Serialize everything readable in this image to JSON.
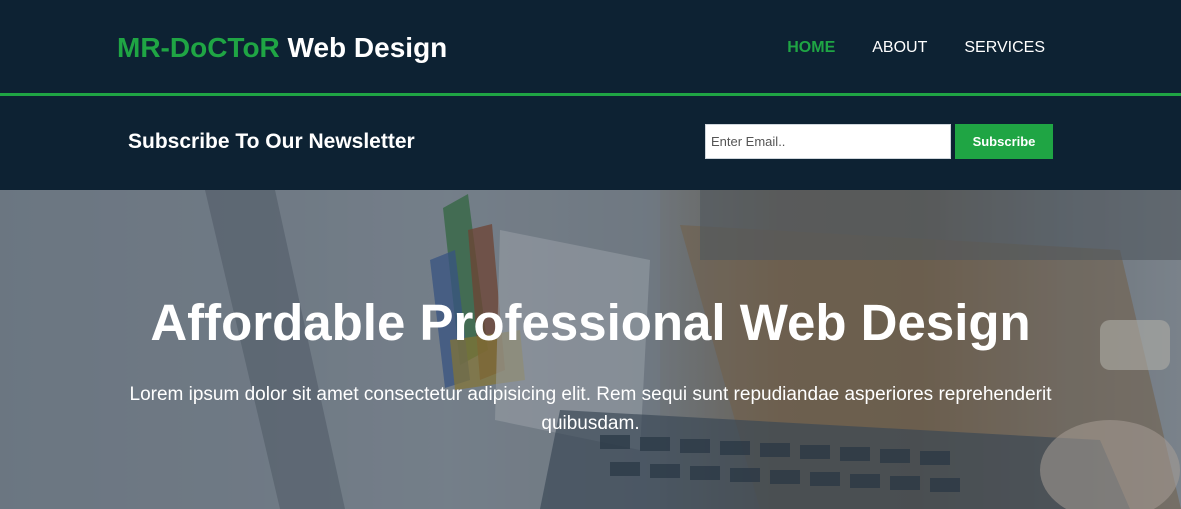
{
  "header": {
    "logo_brand": "MR-DoCToR",
    "logo_rest": " Web Design",
    "nav": [
      {
        "label": "HOME",
        "active": true
      },
      {
        "label": "ABOUT",
        "active": false
      },
      {
        "label": "SERVICES",
        "active": false
      }
    ]
  },
  "newsletter": {
    "title": "Subscribe To Our Newsletter",
    "email_placeholder": "Enter Email..",
    "email_value": "",
    "subscribe_label": "Subscribe"
  },
  "hero": {
    "title": "Affordable Professional Web Design",
    "text": "Lorem ipsum dolor sit amet consectetur adipisicing elit. Rem sequi sunt repudiandae asperiores reprehenderit quibusdam."
  },
  "colors": {
    "brand_green": "#1fa544",
    "header_bg": "#0d2233",
    "text_white": "#ffffff"
  }
}
